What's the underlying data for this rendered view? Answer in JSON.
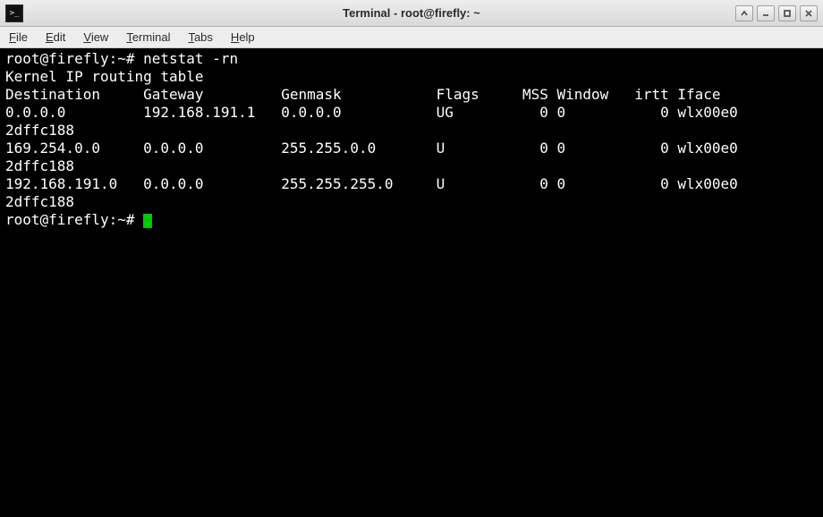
{
  "window": {
    "title": "Terminal - root@firefly: ~",
    "icon_label": ">_"
  },
  "menu": {
    "file": {
      "ul": "F",
      "rest": "ile"
    },
    "edit": {
      "ul": "E",
      "rest": "dit"
    },
    "view": {
      "ul": "V",
      "rest": "iew"
    },
    "terminal": {
      "ul": "T",
      "rest": "erminal"
    },
    "tabs": {
      "ul": "T",
      "rest": "abs"
    },
    "help": {
      "ul": "H",
      "rest": "elp"
    }
  },
  "session": {
    "prompt": "root@firefly:~#",
    "command": "netstat -rn",
    "output_title": "Kernel IP routing table",
    "columns": [
      "Destination",
      "Gateway",
      "Genmask",
      "Flags",
      "MSS",
      "Window",
      "irtt",
      "Iface"
    ],
    "rows": [
      {
        "dest": "0.0.0.0",
        "gw": "192.168.191.1",
        "mask": "0.0.0.0",
        "flags": "UG",
        "mss": "0",
        "win": "0",
        "irtt": "0",
        "iface": "wlx00e0",
        "cont": "2dffc188"
      },
      {
        "dest": "169.254.0.0",
        "gw": "0.0.0.0",
        "mask": "255.255.0.0",
        "flags": "U",
        "mss": "0",
        "win": "0",
        "irtt": "0",
        "iface": "wlx00e0",
        "cont": "2dffc188"
      },
      {
        "dest": "192.168.191.0",
        "gw": "0.0.0.0",
        "mask": "255.255.255.0",
        "flags": "U",
        "mss": "0",
        "win": "0",
        "irtt": "0",
        "iface": "wlx00e0",
        "cont": "2dffc188"
      }
    ]
  }
}
